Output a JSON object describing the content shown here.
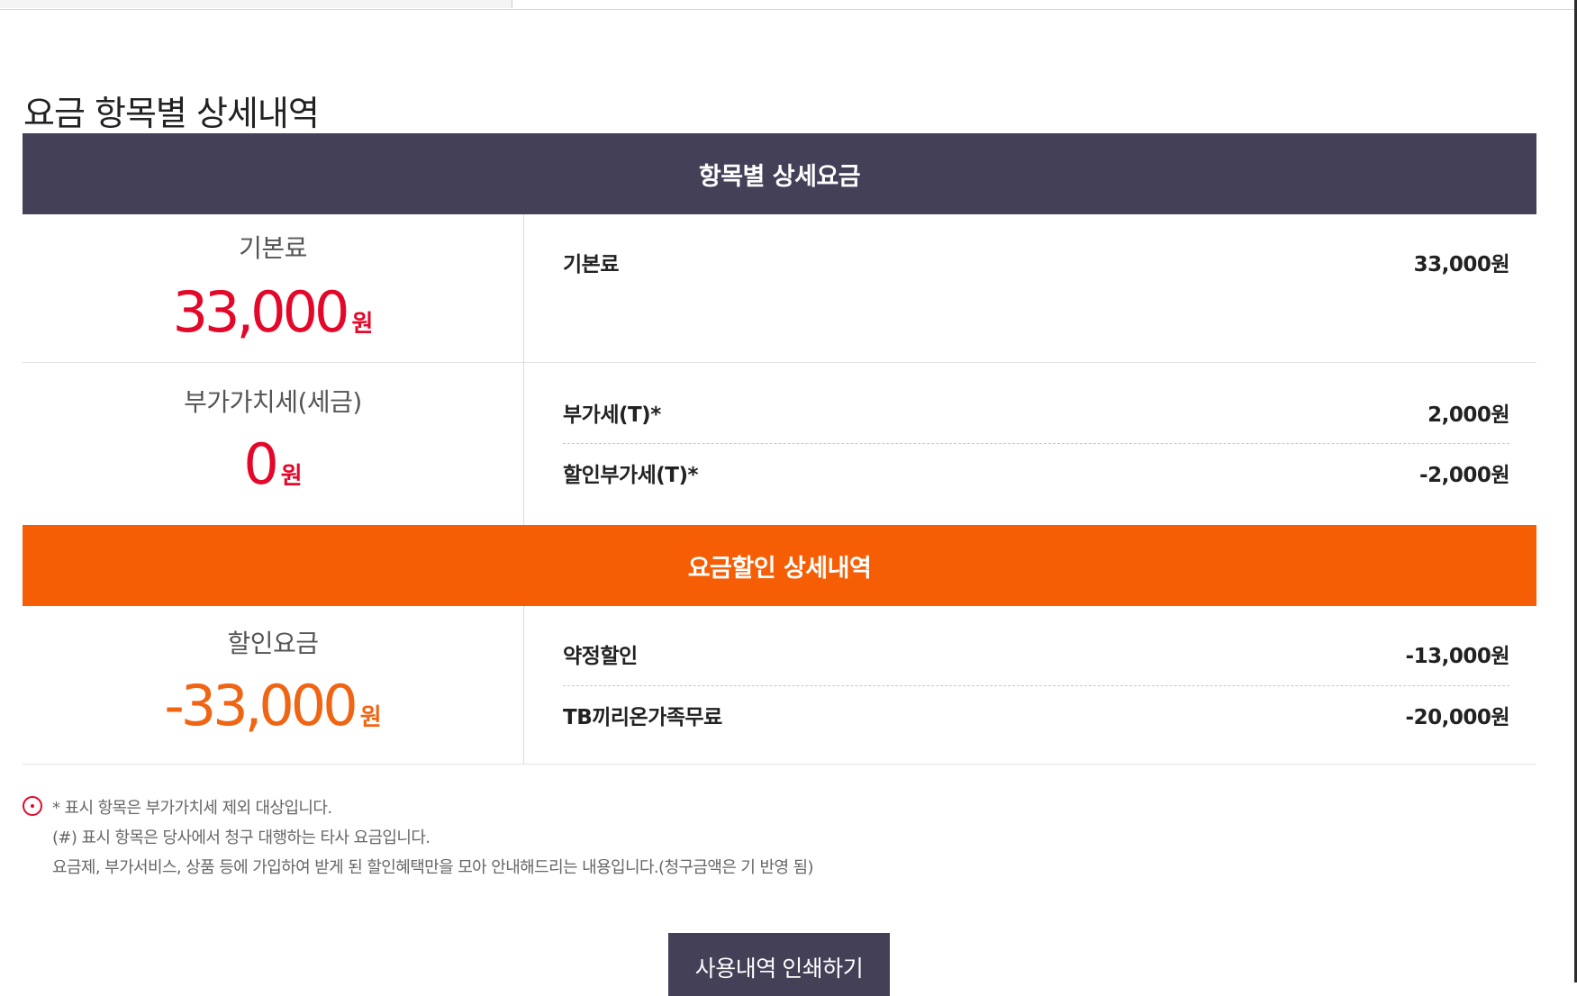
{
  "page_title": "요금 항목별 상세내역",
  "fee_section": {
    "header": "항목별 상세요금",
    "basic": {
      "label": "기본료",
      "amount": "33,000",
      "unit": "원",
      "items": [
        {
          "name": "기본료",
          "value": "33,000원"
        }
      ]
    },
    "vat": {
      "label": "부가가치세(세금)",
      "amount": "0",
      "unit": "원",
      "items": [
        {
          "name": "부가세(T)*",
          "value": "2,000원"
        },
        {
          "name": "할인부가세(T)*",
          "value": "-2,000원"
        }
      ]
    }
  },
  "discount_section": {
    "header": "요금할인 상세내역",
    "label": "할인요금",
    "amount": "-33,000",
    "unit": "원",
    "items": [
      {
        "name": "약정할인",
        "value": "-13,000원"
      },
      {
        "name": "TB끼리온가족무료",
        "value": "-20,000원"
      }
    ]
  },
  "notes": [
    "* 표시 항목은 부가가치세 제외 대상입니다.",
    "(#) 표시 항목은 당사에서 청구 대행하는 타사 요금입니다.",
    "요금제, 부가서비스, 상품 등에 가입하여 받게 된 할인혜택만을 모아 안내해드리는 내용입니다.(청구금액은 기 반영 됨)"
  ],
  "print_button_label": "사용내역 인쇄하기",
  "colors": {
    "header_dark": "#434058",
    "header_orange": "#f65e05",
    "amount_red": "#e3082a",
    "amount_orange": "#f06514"
  }
}
